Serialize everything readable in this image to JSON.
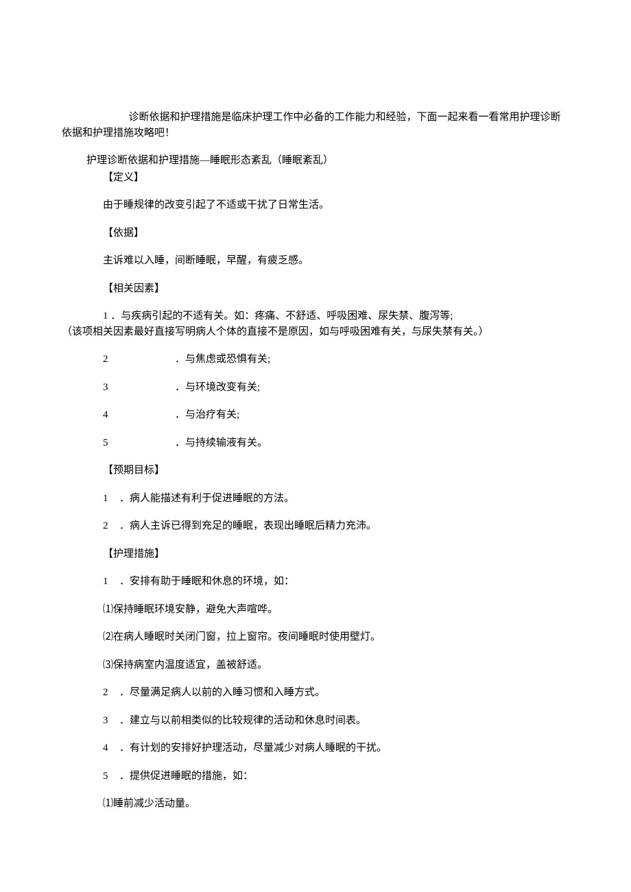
{
  "intro": "诊断依据和护理措施是临床护理工作中必备的工作能力和经验，下面一起来看一看常用护理诊断依据和护理措施攻略吧！",
  "title": "护理诊断依据和护理措施—睡眠形态紊乱（睡眠紊乱）",
  "sec_def_h": "【定义】",
  "sec_def_body": "由于睡规律的改变引起了不适或干扰了日常生活。",
  "sec_basis_h": "【依据】",
  "sec_basis_body": "主诉难以入睡，间断睡眠，早醒，有疲乏感。",
  "sec_factors_h": "【相关因素】",
  "factor1_line1": "1 ．与疾病引起的不适有关。如：疼痛、不舒适、呼吸困难、尿失禁、腹泻等;",
  "factor1_line2": "（该项相关因素最好直接写明病人个体的直接不是原因，如与呼吸困难有关，与尿失禁有关。）",
  "f2_n": "2",
  "f2_t": "．与焦虑或恐惧有关;",
  "f3_n": "3",
  "f3_t": "．与环境改变有关;",
  "f4_n": "4",
  "f4_t": "．与治疗有关;",
  "f5_n": "5",
  "f5_t": "．与持续输液有关。",
  "sec_goal_h": "【预期目标】",
  "g1_n": "1",
  "g1_t": "．病人能描述有利于促进睡眠的方法。",
  "g2_n": "2",
  "g2_t": "．病人主诉已得到充足的睡眠，表现出睡眠后精力充沛。",
  "sec_measure_h": "【护理措施】",
  "m1_n": "1",
  "m1_t": "．安排有助于睡眠和休息的环境，如：",
  "m1_1": "⑴保持睡眠环境安静，避免大声喧哗。",
  "m1_2": "⑵在病人睡眠时关闭门窗，拉上窗帘。夜间睡眠时使用壁灯。",
  "m1_3": "⑶保持病室内温度适宜，盖被舒适。",
  "m2_n": "2",
  "m2_t": "．尽量满足病人以前的入睡习惯和入睡方式。",
  "m3_n": "3",
  "m3_t": "．建立与以前相类似的比较规律的活动和休息时间表。",
  "m4_n": "4",
  "m4_t": "．有计划的安排好护理活动，尽量减少对病人睡眠的干扰。",
  "m5_n": "5",
  "m5_t": "．提供促进睡眠的措施，如：",
  "m5_1": "⑴睡前减少活动量。"
}
